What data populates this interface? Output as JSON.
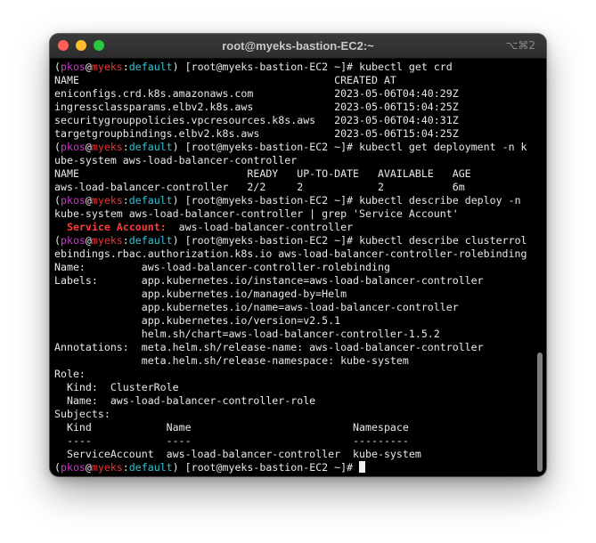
{
  "window": {
    "title": "root@myeks-bastion-EC2:~",
    "shortcut": "⌥⌘2"
  },
  "prompt": {
    "open": "(",
    "user": "pkos",
    "at": "@",
    "host": "myeks",
    "colon": ":",
    "ns": "default",
    "rest": ") [root@myeks-bastion-EC2 ~]# "
  },
  "lines": [
    {
      "prompt": true,
      "text": "kubectl get crd"
    },
    {
      "text": "NAME                                         CREATED AT"
    },
    {
      "text": "eniconfigs.crd.k8s.amazonaws.com             2023-05-06T04:40:29Z"
    },
    {
      "text": "ingressclassparams.elbv2.k8s.aws             2023-05-06T15:04:25Z"
    },
    {
      "text": "securitygrouppolicies.vpcresources.k8s.aws   2023-05-06T04:40:31Z"
    },
    {
      "text": "targetgroupbindings.elbv2.k8s.aws            2023-05-06T15:04:25Z"
    },
    {
      "prompt": true,
      "text": "kubectl get deployment -n k"
    },
    {
      "text": "ube-system aws-load-balancer-controller"
    },
    {
      "text": "NAME                           READY   UP-TO-DATE   AVAILABLE   AGE"
    },
    {
      "text": "aws-load-balancer-controller   2/2     2            2           6m"
    },
    {
      "prompt": true,
      "text": "kubectl describe deploy -n"
    },
    {
      "text": "kube-system aws-load-balancer-controller | grep 'Service Account'"
    },
    {
      "sa": true,
      "pre": "  ",
      "label": "Service Account:",
      "text": "  aws-load-balancer-controller"
    },
    {
      "prompt": true,
      "text": "kubectl describe clusterrol"
    },
    {
      "text": "ebindings.rbac.authorization.k8s.io aws-load-balancer-controller-rolebinding"
    },
    {
      "text": "Name:         aws-load-balancer-controller-rolebinding"
    },
    {
      "text": "Labels:       app.kubernetes.io/instance=aws-load-balancer-controller"
    },
    {
      "text": "              app.kubernetes.io/managed-by=Helm"
    },
    {
      "text": "              app.kubernetes.io/name=aws-load-balancer-controller"
    },
    {
      "text": "              app.kubernetes.io/version=v2.5.1"
    },
    {
      "text": "              helm.sh/chart=aws-load-balancer-controller-1.5.2"
    },
    {
      "text": "Annotations:  meta.helm.sh/release-name: aws-load-balancer-controller"
    },
    {
      "text": "              meta.helm.sh/release-namespace: kube-system"
    },
    {
      "text": "Role:"
    },
    {
      "text": "  Kind:  ClusterRole"
    },
    {
      "text": "  Name:  aws-load-balancer-controller-role"
    },
    {
      "text": "Subjects:"
    },
    {
      "text": "  Kind            Name                          Namespace"
    },
    {
      "text": "  ----            ----                          ---------"
    },
    {
      "text": "  ServiceAccount  aws-load-balancer-controller  kube-system"
    },
    {
      "prompt": true,
      "text": "",
      "cursor": true
    }
  ]
}
